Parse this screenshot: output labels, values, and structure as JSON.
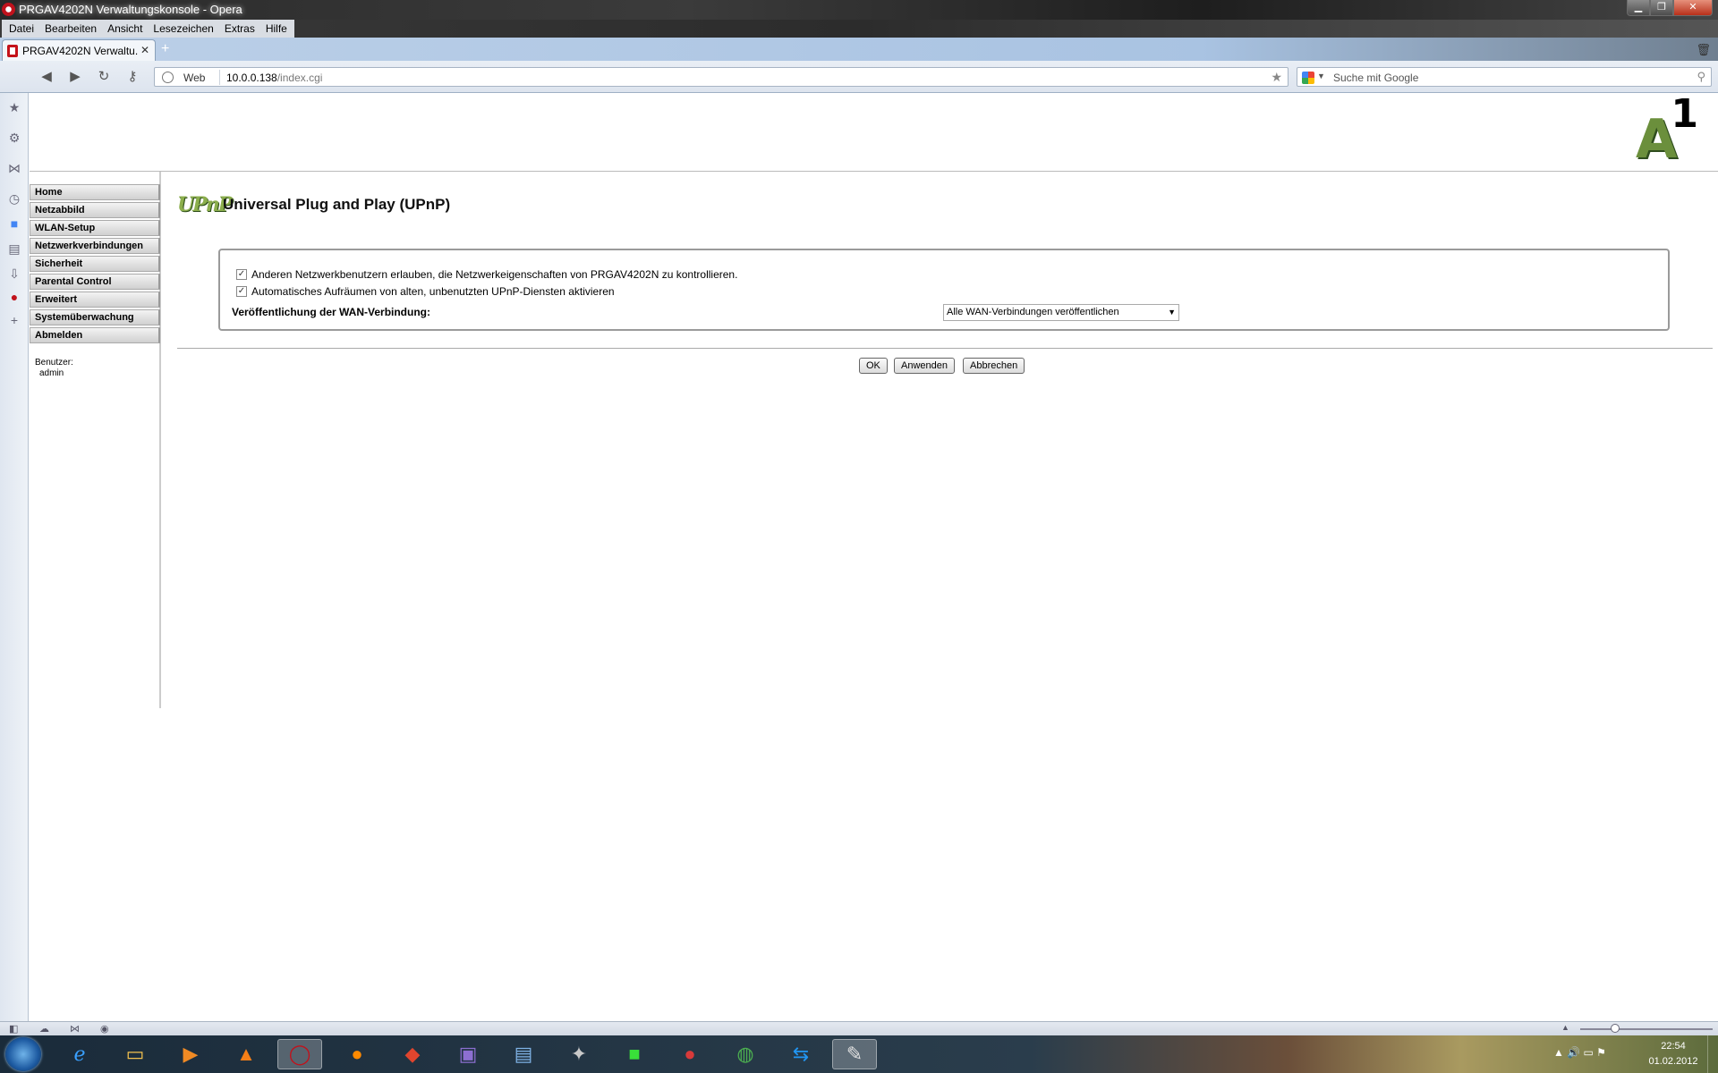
{
  "window": {
    "title": "PRGAV4202N Verwaltungskonsole - Opera",
    "minimize": "▁",
    "restore": "❐",
    "close": "✕"
  },
  "menubar": {
    "items": [
      "Datei",
      "Bearbeiten",
      "Ansicht",
      "Lesezeichen",
      "Extras",
      "Hilfe"
    ]
  },
  "tabs": [
    {
      "label": "PRGAV4202N Verwaltu...",
      "close": "✕"
    }
  ],
  "newtab": "+",
  "address": {
    "web_label": "Web",
    "url_host": "10.0.0.138",
    "url_path": "/index.cgi",
    "search_placeholder": "Suche mit Google"
  },
  "router": {
    "brand_one": "1",
    "brand_a": "A",
    "page_title": "Universal Plug and Play (UPnP)",
    "upnp_logo": "UPnP",
    "nav": [
      "Home",
      "Netzabbild",
      "WLAN-Setup",
      "Netzwerkverbindungen",
      "Sicherheit",
      "Parental Control",
      "Erweitert",
      "Systemüberwachung",
      "Abmelden"
    ],
    "user_label": "Benutzer:",
    "user_name": "admin",
    "options": [
      {
        "label": "Anderen Netzwerkbenutzern erlauben, die Netzwerkeigenschaften von PRGAV4202N zu kontrollieren.",
        "checked": true
      },
      {
        "label": "Automatisches Aufräumen von alten, unbenutzten UPnP-Diensten aktivieren",
        "checked": true
      }
    ],
    "wan_label": "Veröffentlichung der WAN-Verbindung:",
    "wan_selected": "Alle WAN-Verbindungen veröffentlichen",
    "buttons": {
      "ok": "OK",
      "apply": "Anwenden",
      "cancel": "Abbrechen"
    }
  },
  "clock": {
    "time": "22:54",
    "date": "01.02.2012"
  }
}
